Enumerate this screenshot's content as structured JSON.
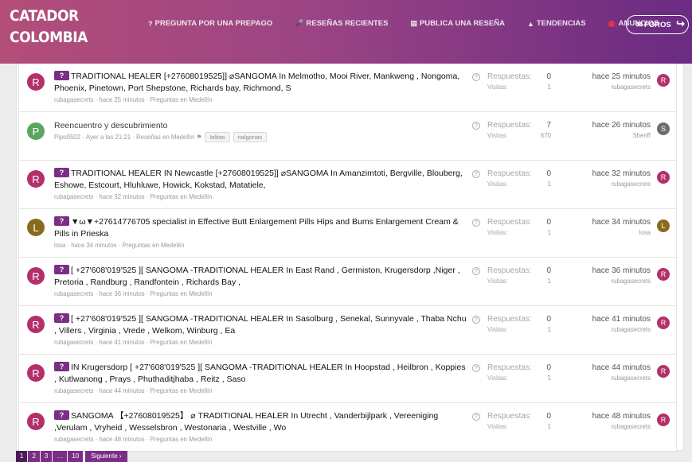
{
  "header": {
    "logo_line1": "CATADOR",
    "logo_line2": "COLOMBIA",
    "nav": [
      {
        "label": "PREGUNTA POR UNA PREPAGO",
        "icon": "question-circle-icon"
      },
      {
        "label": "RESEÑAS RECIENTES",
        "icon": "microphone-icon"
      },
      {
        "label": "PUBLICA UNA RESEÑA",
        "icon": "document-icon"
      },
      {
        "label": "TENDENCIAS",
        "icon": "fire-icon"
      },
      {
        "label": "ANUNCIOS",
        "icon": "red-dot-icon"
      }
    ],
    "foros_label": "FOROS"
  },
  "colors": {
    "header_left": "#b34e79",
    "header_right": "#6a2b82",
    "badge": "#7b2e86"
  },
  "threads": [
    {
      "avatar_letter": "R",
      "avatar_color": "#b3306b",
      "badge": "?",
      "title": "TRADITIONAL HEALER [+27608019525]] ⌀SANGOMA In Melmotho, Mooi River, Mankweng , Nongoma, Phoenix, Pinetown, Port Shepstone, Richards bay, Richmond, S",
      "author": "rubagasecrets",
      "time": "hace 25 minutos",
      "forum": "Preguntas en Medellín",
      "replies_label": "Respuestas:",
      "replies": "0",
      "views_label": "Visitas:",
      "views": "1",
      "last_time": "hace 25 minutos",
      "last_user": "rubagasecrets",
      "last_av": "R"
    },
    {
      "avatar_letter": "P",
      "avatar_color": "#5ba55c",
      "badge": "",
      "title": "Reencuentro y descubrimiento",
      "author": "Pipo9502",
      "time": "Ayer a las 21:21",
      "forum": "Reseñas en Medellín",
      "tags": [
        "lolitas",
        "nalgonas"
      ],
      "replies_label": "Respuestas:",
      "replies": "7",
      "views_label": "Visitas:",
      "views": "670",
      "last_time": "hace 26 minutos",
      "last_user": "Sheriff",
      "last_av": "S"
    },
    {
      "avatar_letter": "R",
      "avatar_color": "#b3306b",
      "badge": "?",
      "title": "TRADITIONAL HEALER IN Newcastle [+27608019525]] ⌀SANGOMA In Amanzimtoti, Bergville, Blouberg, Eshowe, Estcourt, Hluhluwe, Howick, Kokstad, Matatiele,",
      "author": "rubagasecrets",
      "time": "hace 32 minutos",
      "forum": "Preguntas en Medellín",
      "replies_label": "Respuestas:",
      "replies": "0",
      "views_label": "Visitas:",
      "views": "1",
      "last_time": "hace 32 minutos",
      "last_user": "rubagasecrets",
      "last_av": "R"
    },
    {
      "avatar_letter": "L",
      "avatar_color": "#8a6a1c",
      "badge": "?",
      "title": "▼ω▼+27614776705 specialist in Effective Butt Enlargement Pills Hips and Bums Enlargement Cream & Pills in Prieska",
      "author": "losa",
      "time": "hace 34 minutos",
      "forum": "Preguntas en Medellín",
      "replies_label": "Respuestas:",
      "replies": "0",
      "views_label": "Visitas:",
      "views": "1",
      "last_time": "hace 34 minutos",
      "last_user": "losa",
      "last_av": "L"
    },
    {
      "avatar_letter": "R",
      "avatar_color": "#b3306b",
      "badge": "?",
      "title": "[ +27'608'019'525 ][ SANGOMA -TRADITIONAL HEALER In East Rand , Germiston, Krugersdorp ,Niger , Pretoria , Randburg , Randfontein , Richards Bay ,",
      "author": "rubagasecrets",
      "time": "hace 36 minutos",
      "forum": "Preguntas en Medellín",
      "replies_label": "Respuestas:",
      "replies": "0",
      "views_label": "Visitas:",
      "views": "1",
      "last_time": "hace 36 minutos",
      "last_user": "rubagasecrets",
      "last_av": "R"
    },
    {
      "avatar_letter": "R",
      "avatar_color": "#b3306b",
      "badge": "?",
      "title": "[ +27'608'019'525 ][ SANGOMA -TRADITIONAL HEALER In Sasolburg , Senekal, Sunnyvale , Thaba Nchu , Villers , Virginia , Vrede , Welkom, Winburg , Ea",
      "author": "rubagasecrets",
      "time": "hace 41 minutos",
      "forum": "Preguntas en Medellín",
      "replies_label": "Respuestas:",
      "replies": "0",
      "views_label": "Visitas:",
      "views": "1",
      "last_time": "hace 41 minutos",
      "last_user": "rubagasecrets",
      "last_av": "R"
    },
    {
      "avatar_letter": "R",
      "avatar_color": "#b3306b",
      "badge": "?",
      "title": "IN Krugersdorp [ +27'608'019'525 ][ SANGOMA -TRADITIONAL HEALER In Hoopstad , Heilbron , Koppies , Kutlwanong , Prays , Phuthaditjhaba , Reitz , Saso",
      "author": "rubagasecrets",
      "time": "hace 44 minutos",
      "forum": "Preguntas en Medellín",
      "replies_label": "Respuestas:",
      "replies": "0",
      "views_label": "Visitas:",
      "views": "1",
      "last_time": "hace 44 minutos",
      "last_user": "rubagasecrets",
      "last_av": "R"
    },
    {
      "avatar_letter": "R",
      "avatar_color": "#b3306b",
      "badge": "?",
      "title": "SANGOMA 【+27608019525】 ⌀ TRADITIONAL HEALER In Utrecht , Vanderbijlpark , Vereeniging ,Verulam , Vryheid , Wesselsbron , Westonaria , Westville , Wo",
      "author": "rubagasecrets",
      "time": "hace 48 minutos",
      "forum": "Preguntas en Medellín",
      "replies_label": "Respuestas:",
      "replies": "0",
      "views_label": "Visitas:",
      "views": "1",
      "last_time": "hace 48 minutos",
      "last_user": "rubagasecrets",
      "last_av": "R"
    }
  ],
  "pagination": {
    "pages": [
      "1",
      "2",
      "3",
      "…",
      "10"
    ],
    "current": "1",
    "next_label": "Siguiente ›"
  }
}
